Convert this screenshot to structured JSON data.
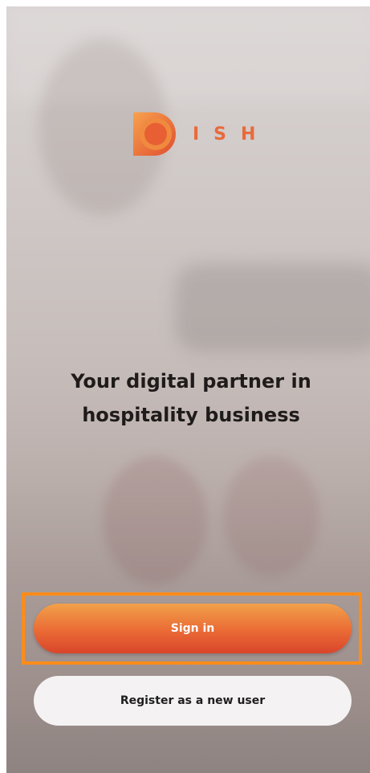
{
  "brand": {
    "name": "ISH"
  },
  "tagline": {
    "line1": "Your digital partner in",
    "line2": "hospitality business"
  },
  "buttons": {
    "sign_in": "Sign in",
    "register": "Register as a new user"
  },
  "colors": {
    "accent": "#e76b3c",
    "button_gradient_top": "#f2a14a",
    "button_gradient_bottom": "#d9452b",
    "highlight": "#ff8c1a"
  }
}
